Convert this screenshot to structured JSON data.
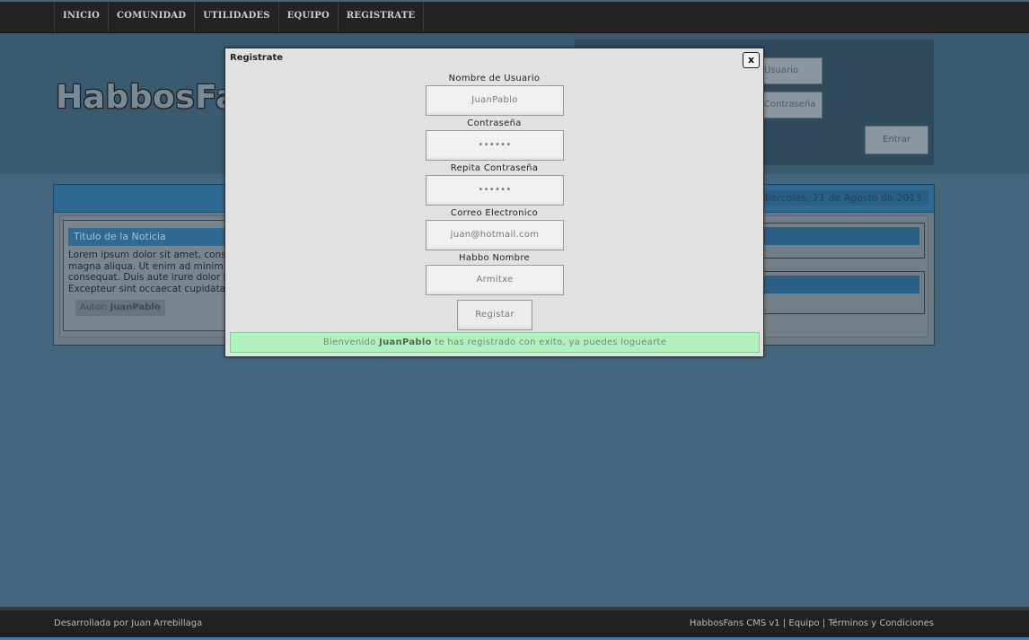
{
  "nav": {
    "items": [
      "INICIO",
      "COMUNIDAD",
      "UTILIDADES",
      "EQUIPO",
      "REGISTRATE"
    ]
  },
  "header": {
    "logo": "HabbosFans",
    "login": {
      "user_placeholder": "Usuario",
      "pass_placeholder": "Contraseña",
      "submit": "Entrar"
    }
  },
  "content": {
    "date": "Miercoles, 21 de Agosto de 2013",
    "news": {
      "title": "Titulo de la Noticia",
      "lines": [
        "Lorem ipsum dolor sit amet, consectetur",
        "magna aliqua. Ut enim ad minim veniam",
        "consequat. Duis aute irure dolor in",
        "Excepteur sint occaecat cupidatat non"
      ],
      "author_label": "Autor:",
      "author": "JuanPablo"
    }
  },
  "modal": {
    "title": "Registrate",
    "close": "x",
    "fields": [
      {
        "label": "Nombre de Usuario",
        "value": "JuanPablo"
      },
      {
        "label": "Contraseña",
        "value": "••••••"
      },
      {
        "label": "Repita Contraseña",
        "value": "••••••"
      },
      {
        "label": "Correo Electronico",
        "value": "juan@hotmail.com"
      },
      {
        "label": "Habbo Nombre",
        "value": "Armitxe"
      }
    ],
    "submit": "Registar",
    "success": {
      "prefix": "Bienvenido",
      "user": "JuanPablo",
      "suffix": "te has registrado con exito, ya puedes loguearte"
    }
  },
  "footer": {
    "left": "Desarrollada por Juan Arrebillaga",
    "right": "HabbosFans CMS v1 | Equipo | Términos y Condiciones"
  },
  "colors": {
    "page_bg": "#44677f",
    "nav_bg": "#232323",
    "accent_blue": "#2f6a94",
    "success_bg": "#b2f1bf"
  }
}
